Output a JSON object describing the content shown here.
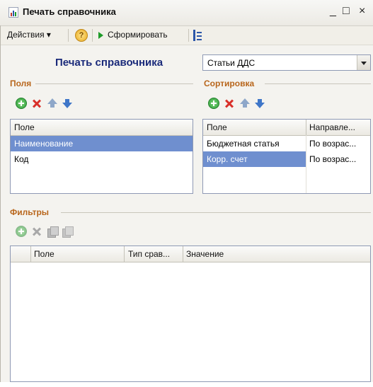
{
  "window": {
    "title": "Печать справочника",
    "controls": [
      "_",
      "□",
      "×"
    ]
  },
  "toolbar": {
    "actions": "Действия",
    "help": "?",
    "generate": "Сформировать"
  },
  "heading": "Печать справочника",
  "directory_select": {
    "value": "Статьи ДДС"
  },
  "fields": {
    "group_title": "Поля",
    "column": "Поле",
    "rows": [
      {
        "name": "Наименование",
        "selected": true
      },
      {
        "name": "Код",
        "selected": false
      }
    ]
  },
  "sorting": {
    "group_title": "Сортировка",
    "columns": [
      "Поле",
      "Направле..."
    ],
    "rows": [
      {
        "field": "Бюджетная статья",
        "direction": "По возрас...",
        "selected": false
      },
      {
        "field": "Корр. счет",
        "direction": "По возрас...",
        "selected": true
      }
    ]
  },
  "filters": {
    "group_title": "Фильтры",
    "columns": [
      "Поле",
      "Тип срав...",
      "Значение"
    ]
  },
  "colors": {
    "selection": "#6f8fcf",
    "group_title": "#b8661c",
    "heading": "#1a2a7a"
  }
}
